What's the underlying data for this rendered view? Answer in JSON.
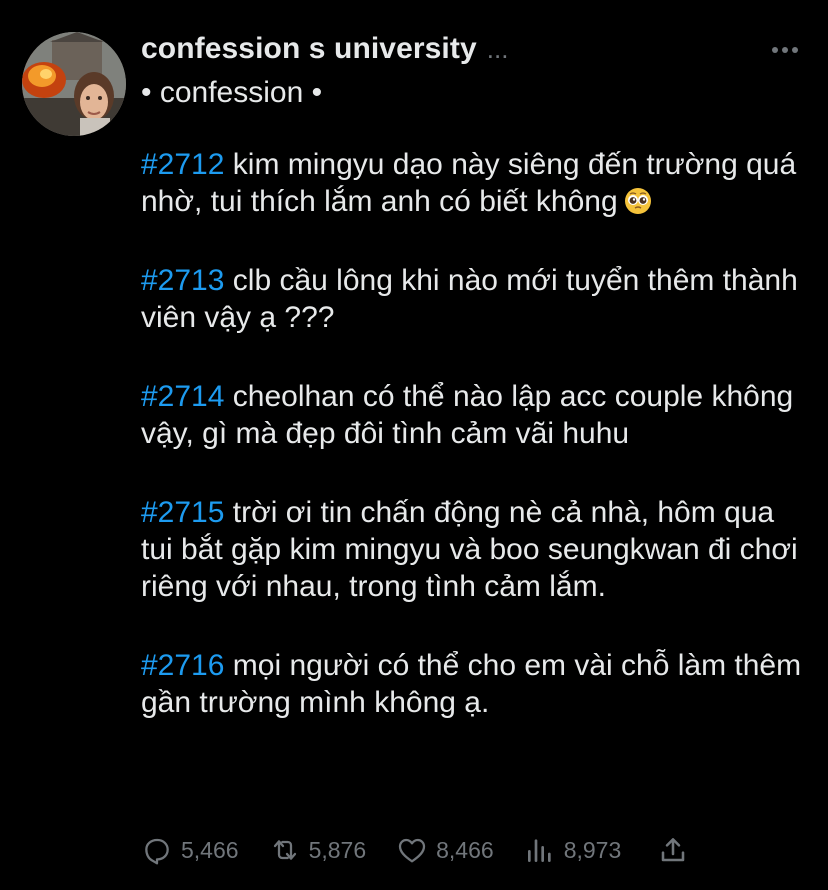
{
  "author": {
    "name": "confession s university",
    "name_overflow": "...",
    "handle": "• confession •"
  },
  "icons": {
    "more": "more-horizontal-icon",
    "reply": "reply-icon",
    "retweet": "retweet-icon",
    "like": "heart-icon",
    "views": "views-icon",
    "share": "share-icon"
  },
  "colors": {
    "background": "#000000",
    "text": "#e7e9ea",
    "hashtag": "#1d9bf0",
    "muted": "#71767b"
  },
  "posts": [
    {
      "tag": "#2712",
      "text": " kim mingyu dạo này siêng đến trường quá nhờ, tui thích lắm anh có biết không",
      "emoji": "pleading-face-icon"
    },
    {
      "tag": "#2713",
      "text": " clb cầu lông khi nào mới tuyển thêm thành viên vậy ạ ???"
    },
    {
      "tag": "#2714",
      "text": " cheolhan có thể nào lập acc couple không vậy, gì mà đẹp đôi tình cảm vãi huhu"
    },
    {
      "tag": "#2715",
      "text": " trời ơi tin chấn động nè cả nhà, hôm qua tui bắt gặp kim mingyu và boo seungkwan đi chơi riêng với nhau, trong tình cảm lắm."
    },
    {
      "tag": "#2716",
      "text": " mọi người có thể cho em vài chỗ làm thêm gần trường mình không ạ."
    }
  ],
  "stats": {
    "replies": "5,466",
    "retweets": "5,876",
    "likes": "8,466",
    "views": "8,973"
  }
}
